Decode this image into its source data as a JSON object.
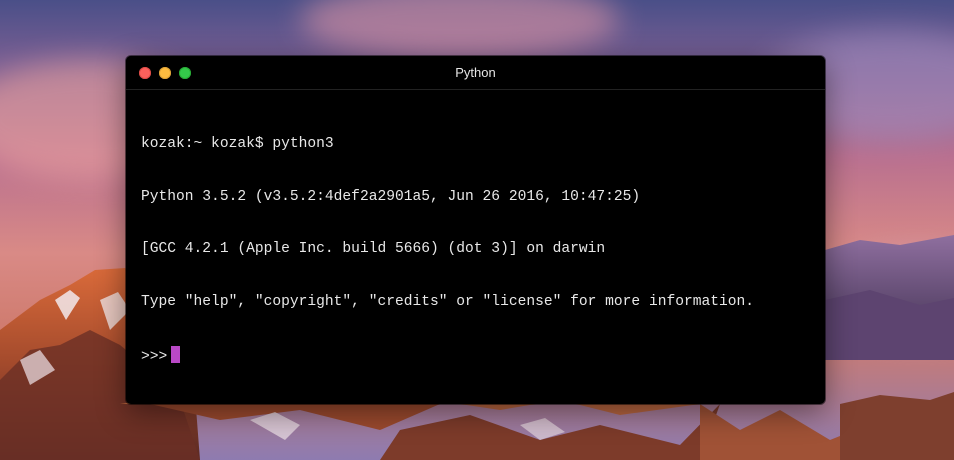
{
  "window": {
    "title": "Python"
  },
  "terminal": {
    "lines": [
      "kozak:~ kozak$ python3",
      "Python 3.5.2 (v3.5.2:4def2a2901a5, Jun 26 2016, 10:47:25)",
      "[GCC 4.2.1 (Apple Inc. build 5666) (dot 3)] on darwin",
      "Type \"help\", \"copyright\", \"credits\" or \"license\" for more information."
    ],
    "prompt": ">>>",
    "cursor_color": "#b948c6"
  },
  "colors": {
    "close": "#fc605c",
    "minimize": "#fdbc40",
    "maximize": "#34c84a"
  }
}
